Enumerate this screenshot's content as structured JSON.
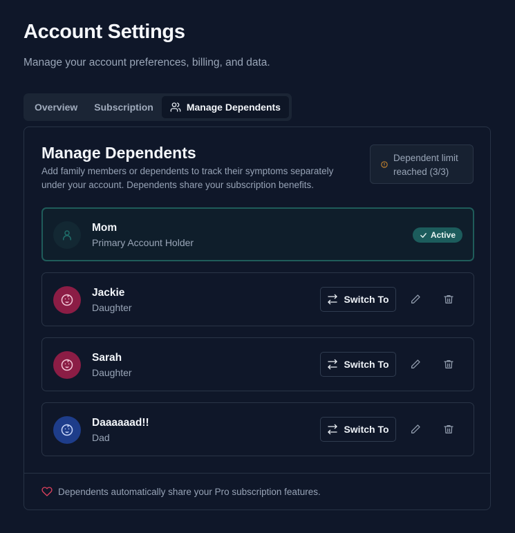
{
  "page": {
    "title": "Account Settings",
    "subtitle": "Manage your account preferences, billing, and data."
  },
  "tabs": [
    {
      "label": "Overview",
      "active": false
    },
    {
      "label": "Subscription",
      "active": false
    },
    {
      "label": "Manage Dependents",
      "active": true,
      "icon": "users-icon"
    }
  ],
  "dependents": {
    "title": "Manage Dependents",
    "description": "Add family members or dependents to track their symptoms separately under your account. Dependents share your subscription benefits.",
    "limit_notice": "Dependent limit reached (3/3)",
    "primary": {
      "name": "Mom",
      "role": "Primary Account Holder",
      "status": "Active",
      "icon": "user-icon"
    },
    "members": [
      {
        "name": "Jackie",
        "role": "Daughter",
        "avatar_color": "#8b1d45",
        "icon": "baby-icon"
      },
      {
        "name": "Sarah",
        "role": "Daughter",
        "avatar_color": "#8b1d45",
        "icon": "baby-icon"
      },
      {
        "name": "Daaaaaad!!",
        "role": "Dad",
        "avatar_color": "#1e3d8a",
        "icon": "baby-icon"
      }
    ],
    "switch_label": "Switch To",
    "footer_note": "Dependents automatically share your Pro subscription features."
  },
  "colors": {
    "background": "#0f1729",
    "accent_teal": "#1c5c5c",
    "heart": "#e0415e",
    "warning": "#d08a2e"
  }
}
